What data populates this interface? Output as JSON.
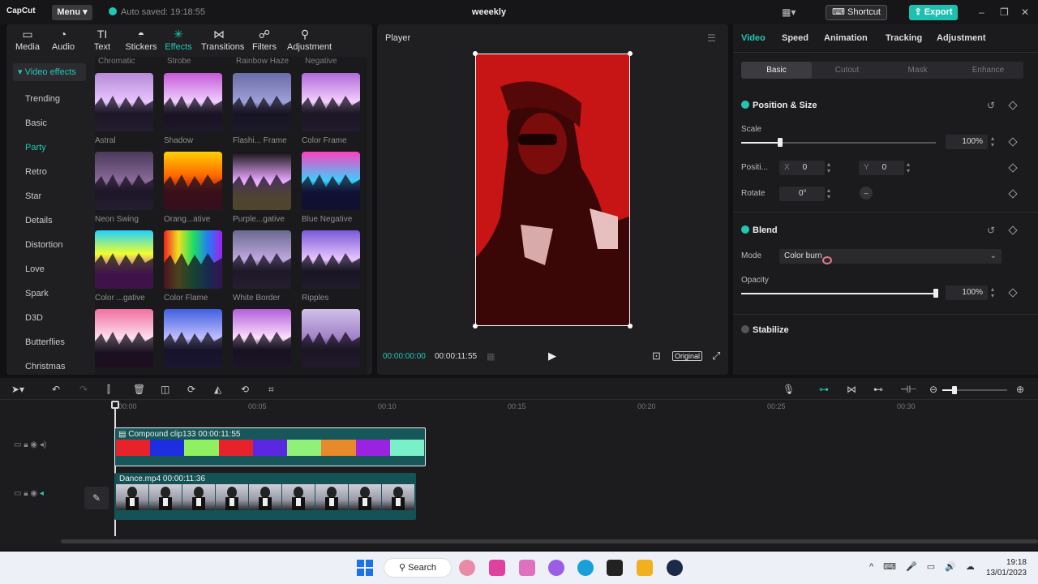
{
  "app": {
    "logo": "CapCut",
    "menu": "Menu",
    "autosave": "Auto saved: 19:18:55",
    "project": "weeekly",
    "shortcut": "Shortcut",
    "export": "Export"
  },
  "toptabs": [
    {
      "label": "Media",
      "icon": "media-icon"
    },
    {
      "label": "Audio",
      "icon": "audio-icon"
    },
    {
      "label": "Text",
      "icon": "text-icon"
    },
    {
      "label": "Stickers",
      "icon": "stickers-icon"
    },
    {
      "label": "Effects",
      "icon": "effects-icon"
    },
    {
      "label": "Transitions",
      "icon": "transitions-icon"
    },
    {
      "label": "Filters",
      "icon": "filters-icon"
    },
    {
      "label": "Adjustment",
      "icon": "adjustment-icon"
    }
  ],
  "categories": {
    "head": "▾ Video effects",
    "items": [
      "Trending",
      "Basic",
      "Party",
      "Retro",
      "Star",
      "Details",
      "Distortion",
      "Love",
      "Spark",
      "D3D",
      "Butterflies",
      "Christmas"
    ],
    "active": "Party"
  },
  "top_labels": [
    "Chromatic",
    "Strobe",
    "Rainbow Haze",
    "Negative"
  ],
  "effects": [
    {
      "label": "Astral"
    },
    {
      "label": "Shadow"
    },
    {
      "label": "Flashi... Frame"
    },
    {
      "label": "Color Frame"
    },
    {
      "label": "Neon Swing"
    },
    {
      "label": "Orang...ative"
    },
    {
      "label": "Purple...gative"
    },
    {
      "label": "Blue Negative"
    },
    {
      "label": "Color ...gative"
    },
    {
      "label": "Color Flame"
    },
    {
      "label": "White Border"
    },
    {
      "label": "Ripples"
    },
    {
      "label": ""
    },
    {
      "label": ""
    },
    {
      "label": ""
    },
    {
      "label": ""
    }
  ],
  "player": {
    "title": "Player",
    "time_current": "00:00:00:00",
    "time_total": "00:00:11:55",
    "ratio": "Original"
  },
  "right": {
    "tabs": [
      "Video",
      "Speed",
      "Animation",
      "Tracking",
      "Adjustment"
    ],
    "subtabs": [
      "Basic",
      "Cutout",
      "Mask",
      "Enhance"
    ],
    "pos_title": "Position & Size",
    "scale_label": "Scale",
    "scale_value": "100%",
    "position_label": "Positi...",
    "x_label": "X",
    "x_value": "0",
    "y_label": "Y",
    "y_value": "0",
    "rotate_label": "Rotate",
    "rotate_value": "0°",
    "blend_title": "Blend",
    "mode_label": "Mode",
    "mode_value": "Color burn",
    "opacity_label": "Opacity",
    "opacity_value": "100%",
    "stabilize": "Stabilize",
    "scale_fraction": 0.2,
    "opacity_fraction": 1.0
  },
  "timeline": {
    "ruler": [
      "00:00",
      "00:05",
      "00:10",
      "00:15",
      "00:20",
      "00:25",
      "00:30"
    ],
    "clip1": "Compound clip133  00:00:11:55",
    "clip1_colors": [
      "#e8222b",
      "#1b2fe0",
      "#8ff060",
      "#e8222b",
      "#5a28e0",
      "#8ff07a",
      "#e8892b",
      "#9b22e0",
      "#7af0c8"
    ],
    "clip2": "Dance.mp4  00:00:11:36"
  },
  "taskbar": {
    "search": "Search",
    "time": "19:18",
    "date": "13/01/2023"
  }
}
